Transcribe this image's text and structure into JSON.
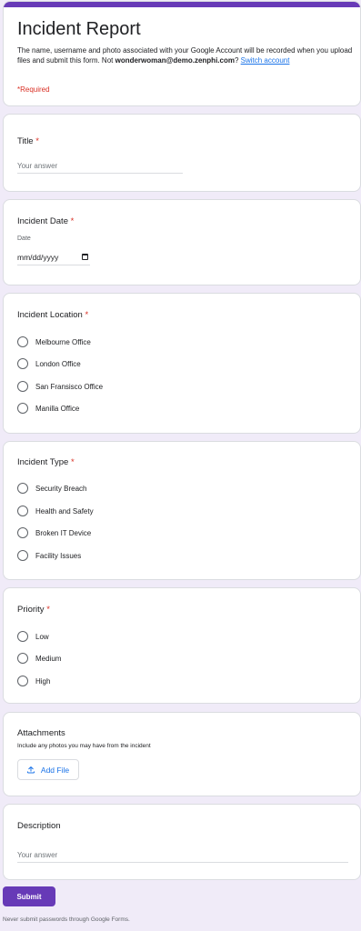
{
  "header": {
    "title": "Incident Report",
    "description_before": "The name, username and photo associated with your Google Account will be recorded when you upload files and submit this form. Not ",
    "email": "wonderwoman@demo.zenphi.com",
    "description_after": "? ",
    "switch_account": "Switch account",
    "required_note": "*Required"
  },
  "questions": {
    "title": {
      "label": "Title",
      "star": "*",
      "placeholder": "Your answer"
    },
    "date": {
      "label": "Incident Date",
      "star": "*",
      "sub_label": "Date",
      "value": "mm/dd/yyyy"
    },
    "location": {
      "label": "Incident Location",
      "star": "*",
      "options": [
        "Melbourne Office",
        "London Office",
        "San Fransisco Office",
        "Manilla Office"
      ]
    },
    "type": {
      "label": "Incident Type",
      "star": "*",
      "options": [
        "Security Breach",
        "Health and Safety",
        "Broken IT Device",
        "Facility Issues"
      ]
    },
    "priority": {
      "label": "Priority",
      "star": "*",
      "options": [
        "Low",
        "Medium",
        "High"
      ]
    },
    "attachments": {
      "label": "Attachments",
      "sub_label": "Include any photos you may have from the incident",
      "button": "Add File"
    },
    "description": {
      "label": "Description",
      "placeholder": "Your answer"
    }
  },
  "submit_label": "Submit",
  "footer_note": "Never submit passwords through Google Forms.",
  "colors": {
    "accent": "#673ab7",
    "required": "#d93025",
    "link": "#1a73e8",
    "background": "#f0ebf8"
  },
  "icons": {
    "date": "calendar-icon",
    "upload": "upload-icon"
  }
}
